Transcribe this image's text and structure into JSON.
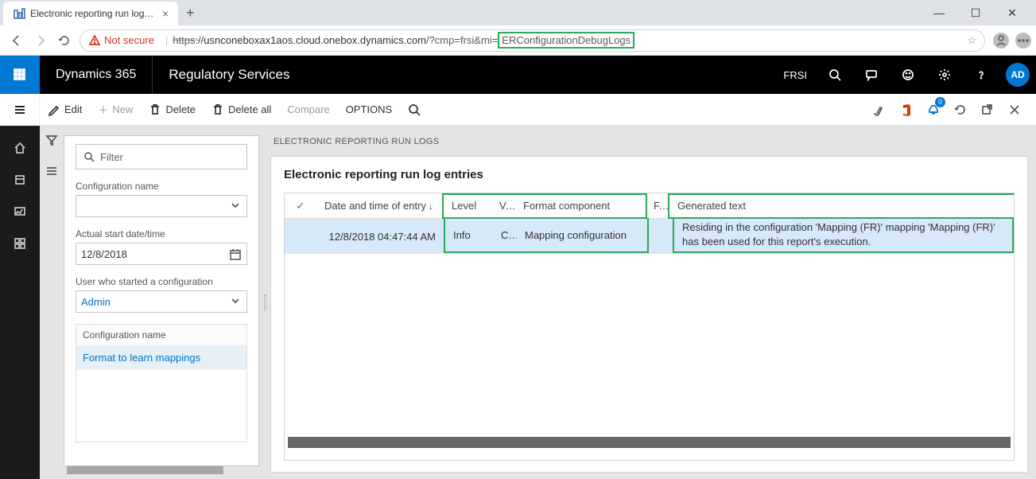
{
  "browser": {
    "tab_title": "Electronic reporting run logs -- R...",
    "url_prefix": "https://",
    "url_host": "usnconeboxax1aos.cloud.onebox.dynamics.com",
    "url_query": "/?cmp=frsi&mi=",
    "url_highlight": "ERConfigurationDebugLogs",
    "not_secure": "Not secure"
  },
  "header": {
    "product": "Dynamics 365",
    "service": "Regulatory Services",
    "company": "FRSI",
    "avatar": "AD"
  },
  "toolbar": {
    "edit": "Edit",
    "new": "New",
    "delete": "Delete",
    "delete_all": "Delete all",
    "compare": "Compare",
    "options": "OPTIONS"
  },
  "filter": {
    "placeholder": "Filter",
    "config_name_label": "Configuration name",
    "actual_start_label": "Actual start date/time",
    "actual_start_value": "12/8/2018",
    "user_label": "User who started a configuration",
    "user_value": "Admin",
    "sublist_header": "Configuration name",
    "sublist_item": "Format to learn mappings"
  },
  "content": {
    "breadcrumb": "ELECTRONIC REPORTING RUN LOGS",
    "card_title": "Electronic reporting run log entries",
    "columns": {
      "date": "Date and time of entry",
      "level": "Level",
      "v": "V...",
      "component": "Format component",
      "f": "F...",
      "text": "Generated text"
    },
    "row": {
      "date": "12/8/2018 04:47:44 AM",
      "level": "Info",
      "v": "C...",
      "component": "Mapping configuration",
      "f": "",
      "text": "Residing in the configuration 'Mapping (FR)' mapping 'Mapping (FR)' has been used for this report's execution."
    }
  }
}
